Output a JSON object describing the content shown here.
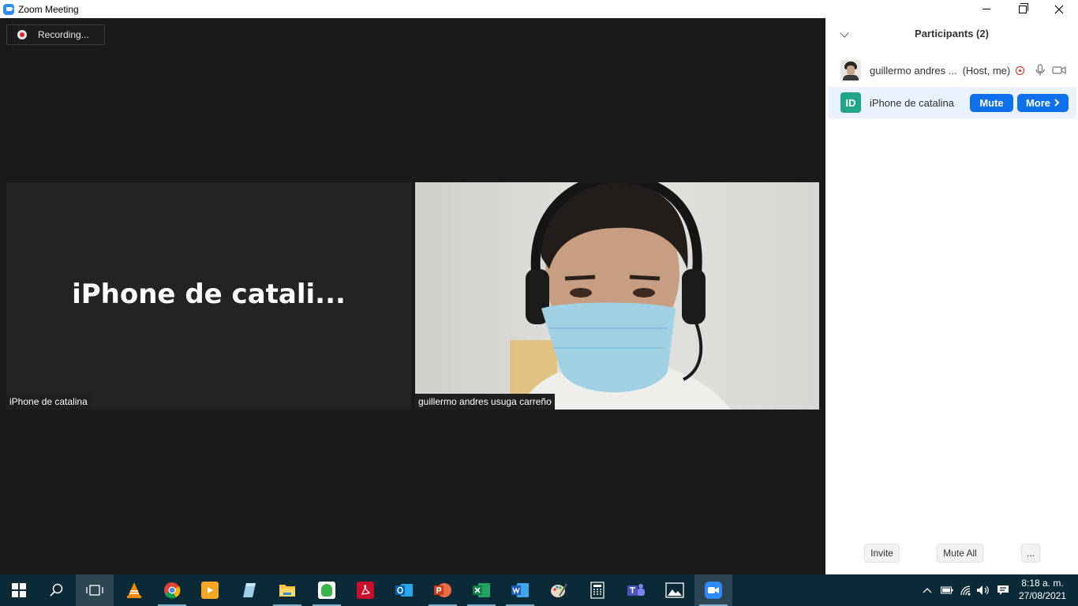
{
  "window": {
    "title": "Zoom Meeting",
    "controls": [
      "minimize",
      "restore",
      "close"
    ]
  },
  "recording": {
    "label": "Recording..."
  },
  "videos": [
    {
      "display_name": "iPhone de catali...",
      "label": "iPhone de catalina",
      "video_on": false
    },
    {
      "label": "guillermo andres usuga carreño",
      "video_on": true
    }
  ],
  "participants_panel": {
    "title": "Participants (2)",
    "participants": [
      {
        "name": "guillermo andres ...",
        "role": "(Host, me)",
        "avatar": "photo",
        "icons": [
          "recording-icon",
          "microphone-icon",
          "video-camera-icon"
        ]
      },
      {
        "name": "iPhone de catalina",
        "initials": "ID",
        "avatar_color": "#20a58a",
        "mute_button": "Mute",
        "more_button": "More"
      }
    ],
    "footer": {
      "invite": "Invite",
      "mute_all": "Mute All",
      "more": "..."
    }
  },
  "taskbar": {
    "apps": [
      "windows-start-icon",
      "search-icon",
      "task-view-icon",
      "vlc-icon",
      "chrome-icon",
      "video-player-icon",
      "notes-icon",
      "file-explorer-icon",
      "green-app-icon",
      "acrobat-icon",
      "outlook-icon",
      "powerpoint-icon",
      "excel-icon",
      "word-icon",
      "paint-icon",
      "calculator-icon",
      "teams-icon",
      "photos-icon",
      "zoom-icon"
    ],
    "clock": {
      "time": "8:18 a. m.",
      "date": "27/08/2021"
    }
  },
  "colors": {
    "accent": "#0e71eb",
    "recording": "#e02828",
    "panel_highlight": "#e9f2fd",
    "taskbar": "#0b2a38"
  }
}
